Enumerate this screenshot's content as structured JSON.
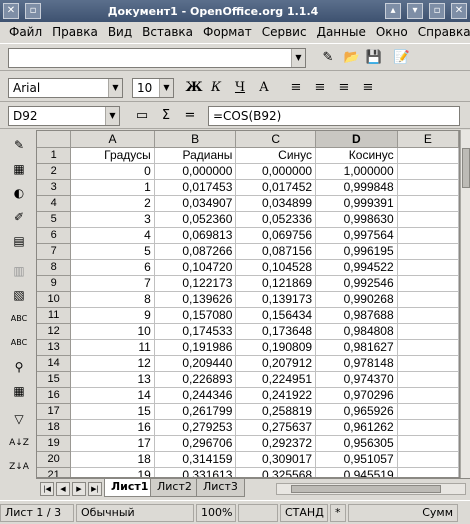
{
  "window": {
    "title": "Документ1 - OpenOffice.org 1.1.4"
  },
  "menu": [
    "Файл",
    "Правка",
    "Вид",
    "Вставка",
    "Формат",
    "Сервис",
    "Данные",
    "Окно",
    "Справка"
  ],
  "font": {
    "name": "Arial",
    "size": "10",
    "bold": "Ж",
    "italic": "К",
    "underline": "Ч"
  },
  "formula_bar": {
    "cell": "D92",
    "sum": "Σ",
    "eq": "=",
    "formula": "=COS(B92)"
  },
  "columns": [
    "A",
    "B",
    "C",
    "D",
    "E"
  ],
  "rows": [
    {
      "n": "1",
      "a": "Градусы",
      "b": "Радианы",
      "c": "Синус",
      "d": "Косинус"
    },
    {
      "n": "2",
      "a": "0",
      "b": "0,000000",
      "c": "0,000000",
      "d": "1,000000"
    },
    {
      "n": "3",
      "a": "1",
      "b": "0,017453",
      "c": "0,017452",
      "d": "0,999848"
    },
    {
      "n": "4",
      "a": "2",
      "b": "0,034907",
      "c": "0,034899",
      "d": "0,999391"
    },
    {
      "n": "5",
      "a": "3",
      "b": "0,052360",
      "c": "0,052336",
      "d": "0,998630"
    },
    {
      "n": "6",
      "a": "4",
      "b": "0,069813",
      "c": "0,069756",
      "d": "0,997564"
    },
    {
      "n": "7",
      "a": "5",
      "b": "0,087266",
      "c": "0,087156",
      "d": "0,996195"
    },
    {
      "n": "8",
      "a": "6",
      "b": "0,104720",
      "c": "0,104528",
      "d": "0,994522"
    },
    {
      "n": "9",
      "a": "7",
      "b": "0,122173",
      "c": "0,121869",
      "d": "0,992546"
    },
    {
      "n": "10",
      "a": "8",
      "b": "0,139626",
      "c": "0,139173",
      "d": "0,990268"
    },
    {
      "n": "11",
      "a": "9",
      "b": "0,157080",
      "c": "0,156434",
      "d": "0,987688"
    },
    {
      "n": "12",
      "a": "10",
      "b": "0,174533",
      "c": "0,173648",
      "d": "0,984808"
    },
    {
      "n": "13",
      "a": "11",
      "b": "0,191986",
      "c": "0,190809",
      "d": "0,981627"
    },
    {
      "n": "14",
      "a": "12",
      "b": "0,209440",
      "c": "0,207912",
      "d": "0,978148"
    },
    {
      "n": "15",
      "a": "13",
      "b": "0,226893",
      "c": "0,224951",
      "d": "0,974370"
    },
    {
      "n": "16",
      "a": "14",
      "b": "0,244346",
      "c": "0,241922",
      "d": "0,970296"
    },
    {
      "n": "17",
      "a": "15",
      "b": "0,261799",
      "c": "0,258819",
      "d": "0,965926"
    },
    {
      "n": "18",
      "a": "16",
      "b": "0,279253",
      "c": "0,275637",
      "d": "0,961262"
    },
    {
      "n": "19",
      "a": "17",
      "b": "0,296706",
      "c": "0,292372",
      "d": "0,956305"
    },
    {
      "n": "20",
      "a": "18",
      "b": "0,314159",
      "c": "0,309017",
      "d": "0,951057"
    },
    {
      "n": "21",
      "a": "19",
      "b": "0,331613",
      "c": "0,325568",
      "d": "0,945519"
    }
  ],
  "tabs": [
    "Лист1",
    "Лист2",
    "Лист3"
  ],
  "status": {
    "sheet": "Лист 1 / 3",
    "style": "Обычный",
    "zoom": "100%",
    "mode": "СТАНД",
    "mark": "*",
    "sum": "Сумм"
  }
}
